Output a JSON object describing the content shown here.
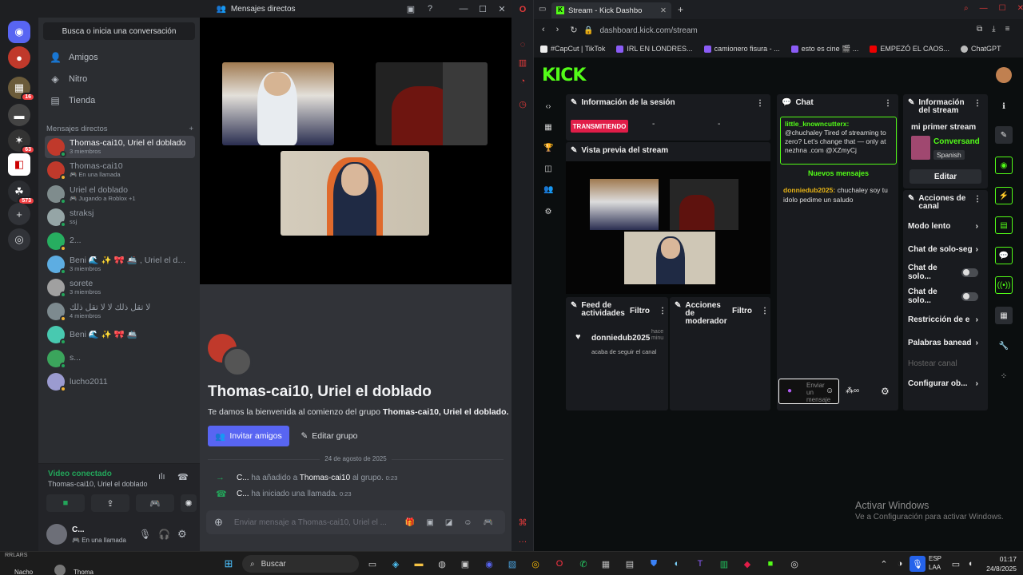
{
  "discord": {
    "window_title": "Mensajes directos",
    "search_placeholder": "Busca o inicia una conversación",
    "nav": [
      "Amigos",
      "Nitro",
      "Tienda"
    ],
    "dm_header": "Mensajes directos",
    "guild_badges": [
      "16",
      "63",
      "573"
    ],
    "dms": [
      {
        "name": "Thomas-cai10, Uriel el doblado",
        "sub": "3 miembros",
        "active": true,
        "color": "#c0392b"
      },
      {
        "name": "Thomas-cai10",
        "sub": "🎮 En una llamada",
        "active": false,
        "color": "#c0392b"
      },
      {
        "name": "Uriel el doblado",
        "sub": "🎮 Jugando a Roblox +1",
        "active": false,
        "color": "#7f8c8d"
      },
      {
        "name": "straksj",
        "sub": "ssj",
        "active": false,
        "color": "#95a5a6"
      },
      {
        "name": "2...",
        "sub": "",
        "active": false,
        "color": "#27ae60"
      },
      {
        "name": "Beni 🌊 ✨ 🎀 🚢 , Uriel el dobl...",
        "sub": "3 miembros",
        "active": false,
        "color": "#5dade2"
      },
      {
        "name": "sorete",
        "sub": "3 miembros",
        "active": false,
        "color": "#a0a0a0"
      },
      {
        "name": "لا تقل ذلك لا لا تقل ذلك",
        "sub": "4 miembros",
        "active": false,
        "color": "#7d8a8f"
      },
      {
        "name": "Beni 🌊 ✨ 🎀 🚢",
        "sub": "",
        "active": false,
        "color": "#48c9b0"
      },
      {
        "name": "s...",
        "sub": "",
        "active": false,
        "color": "#3ba55c"
      },
      {
        "name": "lucho2011",
        "sub": "",
        "active": false,
        "color": "#9b9bd0"
      }
    ],
    "voice": {
      "status": "Video conectado",
      "channel": "Thomas-cai10, Uriel el doblado"
    },
    "user": {
      "name": "C...",
      "status": "En una llamada"
    },
    "welcome": {
      "title": "Thomas-cai10, Uriel el doblado",
      "text_pre": "Te damos la bienvenida al comienzo del grupo ",
      "text_bold": "Thomas-cai10, Uriel el doblado.",
      "invite": "Invitar amigos",
      "edit": "Editar grupo"
    },
    "date_divider": "24 de agosto de 2025",
    "messages": [
      {
        "user": "C...",
        "text": "ha añadido a",
        "target": "Thomas-cai10",
        "tail": "al grupo.",
        "time": "0:23"
      },
      {
        "user": "C...",
        "text": "ha iniciado una llamada.",
        "target": "",
        "tail": "",
        "time": "0:23"
      }
    ],
    "input_placeholder": "Enviar mensaje a Thomas-cai10, Uriel el ..."
  },
  "browser": {
    "tab_title": "Stream - Kick Dashbo",
    "url": "dashboard.kick.com/stream",
    "bookmarks": [
      "#CapCut | TikTok",
      "IRL EN LONDRES...",
      "camionero fisura - ...",
      "esto es cine 🎬 ...",
      "EMPEZÓ EL CAOS...",
      "ChatGPT"
    ]
  },
  "kick": {
    "logo": "KICK",
    "session": {
      "title": "Información de la sesión",
      "live": "TRANSMITIENDO",
      "stat1": "-",
      "stat2": "-"
    },
    "preview_title": "Vista previa del stream",
    "feed": {
      "title": "Feed de actividades",
      "filter": "Filtro",
      "user": "donniedub2025",
      "action": "acaba de seguir el canal",
      "time": "hace minu"
    },
    "mod": {
      "title": "Acciones de moderador",
      "filter": "Filtro"
    },
    "chat": {
      "title": "Chat",
      "pinned_user": "little_knowncutterx:",
      "pinned_text": "@chuchaley Tired of streaming to zero? Let’s change that — only at nezhna .com @XZmyCj",
      "new_label": "Nuevos mensajes",
      "msg_user": "donniedub2025:",
      "msg_text": "chuchaley soy tu idolo pedime un saludo",
      "input": "Enviar un mensaje"
    },
    "info": {
      "title": "Información del stream",
      "stream_title": "mi primer stream",
      "category": "Conversand",
      "language": "Spanish",
      "edit": "Editar"
    },
    "channel_actions": {
      "title": "Acciones de canal",
      "items": [
        "Modo lento",
        "Chat de solo-seg",
        "Chat de solo...",
        "Chat de solo...",
        "Restricción de e",
        "Palabras banead",
        "Hostear canal",
        "Configurar ob..."
      ]
    },
    "activate_1": "Activar Windows",
    "activate_2": "Ve a Configuración para activar Windows."
  },
  "taskbar": {
    "search": "Buscar",
    "left_items": [
      "Nacho",
      "Thoma"
    ],
    "tray_top": "RRLARS",
    "lang1": "ESP",
    "lang2": "LAA",
    "time": "01:17",
    "date": "24/8/2025"
  }
}
